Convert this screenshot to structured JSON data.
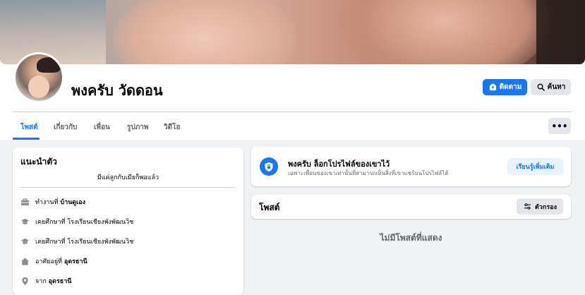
{
  "profile": {
    "name": "พงครับ วัดดอน"
  },
  "actions": {
    "follow_label": "ติดตาม",
    "search_label": "ค้นหา"
  },
  "tabs": [
    {
      "label": "โพสต์"
    },
    {
      "label": "เกี่ยวกับ"
    },
    {
      "label": "เพื่อน"
    },
    {
      "label": "รูปภาพ"
    },
    {
      "label": "วิดีโอ"
    }
  ],
  "more_label": "•••",
  "intro": {
    "title": "แนะนำตัว",
    "bio": "มีแค่ลูกกับเมียก็พอแล้ว",
    "items": [
      {
        "icon": "briefcase-icon",
        "prefix": "ทำงานที่ ",
        "value": "บ้านดูเอง"
      },
      {
        "icon": "graduation-cap-icon",
        "prefix": "เคยศึกษาที่ ",
        "value": "โรงเรียนเชียงพังพัฒนวิช"
      },
      {
        "icon": "graduation-cap-icon",
        "prefix": "เคยศึกษาที่ ",
        "value": "โรงเรียนเชียงพังพัฒนวิช"
      },
      {
        "icon": "home-icon",
        "prefix": "อาศัยอยู่ที่ ",
        "value": "อุดรธานี"
      },
      {
        "icon": "location-pin-icon",
        "prefix": "จาก ",
        "value": "อุดรธานี"
      }
    ]
  },
  "lock_notice": {
    "title": "พงครับ ล็อกโปรไฟล์ของเขาไว้",
    "description": "เฉพาะเพื่อนของเขาเท่านั้นที่สามารถเห็นสิ่งที่เขาแชร์บนโปรไฟล์ได้",
    "learn_more_label": "เรียนรู้เพิ่มเติม"
  },
  "posts": {
    "title": "โพสต์",
    "filter_label": "ตัวกรอง",
    "empty_text": "ไม่มีโพสต์ที่แสดง"
  },
  "colors": {
    "accent": "#1877f2",
    "background": "#f0f2f5",
    "secondary_button": "#e4e6eb",
    "muted_text": "#65676b"
  }
}
